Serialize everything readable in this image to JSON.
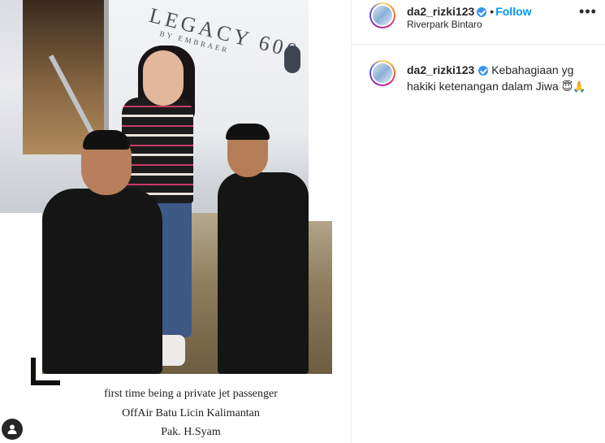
{
  "post": {
    "author": {
      "username": "da2_rizki123",
      "follow_label": "Follow",
      "dot": "•",
      "location": "Riverpark Bintaro"
    },
    "more_label": "•••",
    "photo": {
      "plane_brand": "LEGACY 600",
      "plane_sub": "BY EMBRAER",
      "caption_lines": [
        "first time being a private jet passenger",
        "OffAir Batu Licin Kalimantan",
        "Pak. H.Syam"
      ]
    },
    "caption": {
      "username": "da2_rizki123",
      "text": "Kebahagiaan yg hakiki ketenangan dalam Jiwa",
      "emojis": "😇🙏"
    }
  },
  "icons": {
    "verified": "verified-badge-icon",
    "more": "more-options-icon",
    "tag": "user-tag-icon"
  },
  "colors": {
    "follow": "#0095f6",
    "verified": "#3897f0",
    "text": "#262626"
  }
}
